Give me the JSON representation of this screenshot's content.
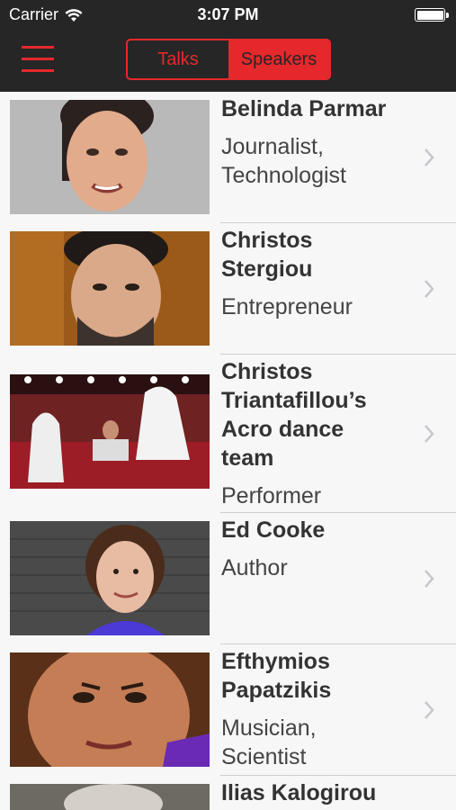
{
  "status_bar": {
    "carrier": "Carrier",
    "time": "3:07 PM"
  },
  "nav": {
    "menu_icon": "hamburger-menu-icon",
    "tabs": [
      {
        "label": "Talks",
        "active": false
      },
      {
        "label": "Speakers",
        "active": true
      }
    ]
  },
  "colors": {
    "accent": "#e5282b",
    "bar": "#262626",
    "list_bg": "#f7f7f7"
  },
  "speakers": [
    {
      "name": "Belinda Parmar",
      "role": "Journalist, Technologist"
    },
    {
      "name": "Christos Stergiou",
      "role": "Entrepreneur"
    },
    {
      "name": "Christos Triantafillou’s Acro dance team",
      "role": "Performer"
    },
    {
      "name": "Ed Cooke",
      "role": "Author"
    },
    {
      "name": "Efthymios Papatzikis",
      "role": "Musician, Scientist"
    },
    {
      "name": "Ilias Kalogirou",
      "role": ""
    }
  ]
}
